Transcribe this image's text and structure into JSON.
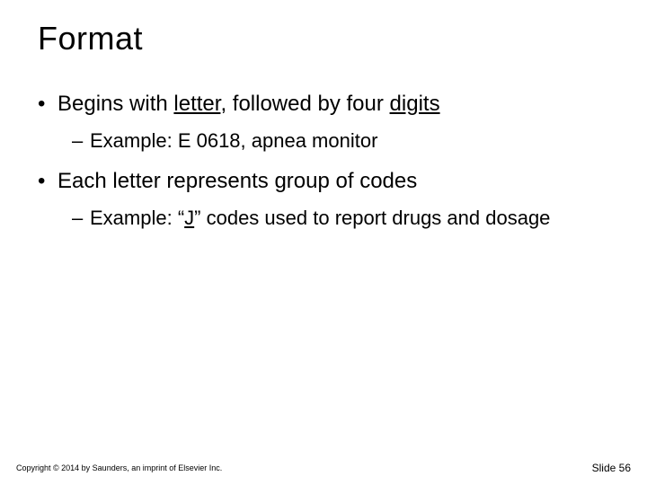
{
  "title": "Format",
  "bullets": {
    "b1": {
      "pre": "Begins with ",
      "u1": "letter",
      "mid": ", followed by four ",
      "u2": "digits"
    },
    "b1_sub": "Example: E 0618, apnea monitor",
    "b2": "Each letter represents group of codes",
    "b2_sub": {
      "pre": "Example: “",
      "u": "J",
      "post": "” codes used to report drugs and dosage"
    }
  },
  "footer": {
    "copyright": "Copyright © 2014 by Saunders, an imprint of Elsevier Inc.",
    "slide": "Slide 56"
  }
}
